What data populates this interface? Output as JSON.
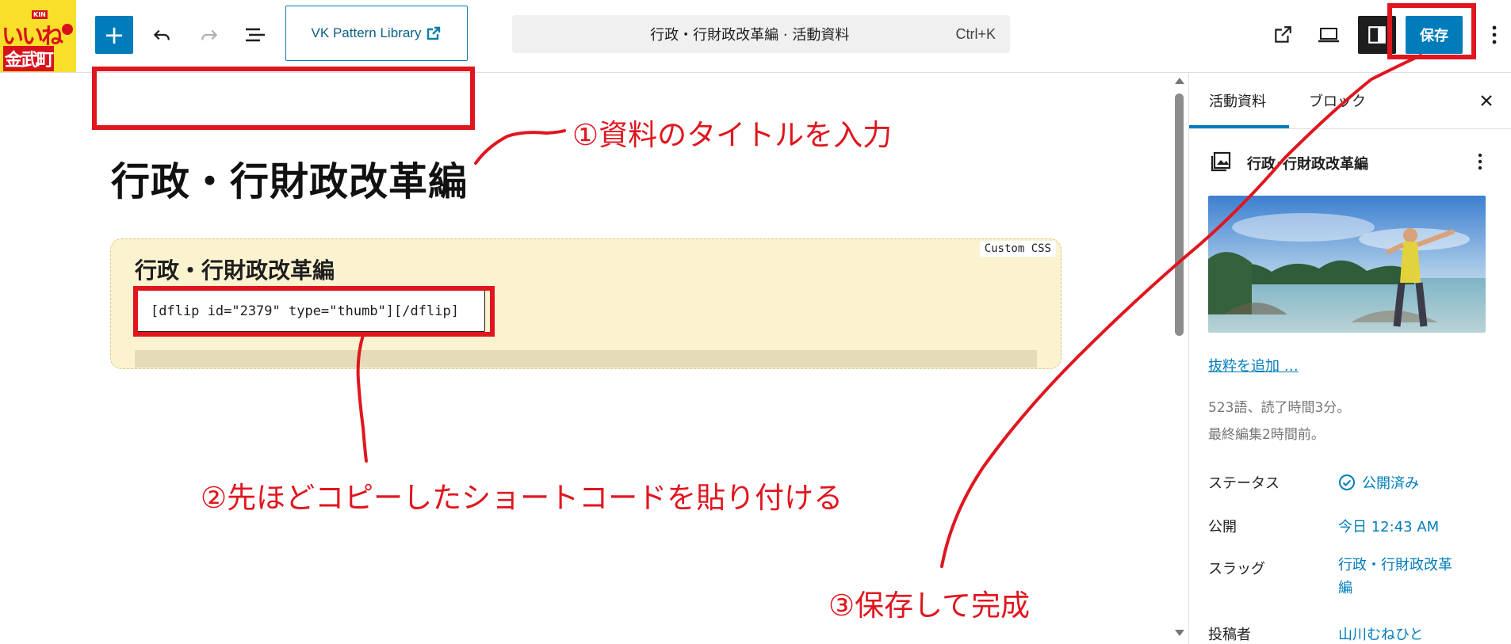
{
  "topbar": {
    "logo": {
      "line1": "いいね",
      "line2": "金武町",
      "badge": "KIN"
    },
    "vk_pattern_label": "VK Pattern Library",
    "command_title": "行政・行財政改革編 · 活動資料",
    "command_shortcut": "Ctrl+K",
    "save_label": "保存",
    "add_label": "+"
  },
  "canvas": {
    "post_title": "行政・行財政改革編",
    "custom_css_label": "Custom CSS",
    "block_heading": "行政・行財政改革編",
    "shortcode": "[dflip id=\"2379\" type=\"thumb\"][/dflip]"
  },
  "annotations": {
    "a1": "①資料のタイトルを入力",
    "a2": "②先ほどコピーしたショートコードを貼り付ける",
    "a3": "③保存して完成"
  },
  "sidebar": {
    "tab_document": "活動資料",
    "tab_block": "ブロック",
    "doc_title": "行政･行財政改革編",
    "add_excerpt": "抜粋を追加 …",
    "word_count": "523語、読了時間3分。",
    "last_edited": "最終編集2時間前。",
    "status_label": "ステータス",
    "status_value": "公開済み",
    "publish_label": "公開",
    "publish_value": "今日 12:43 AM",
    "slug_label": "スラッグ",
    "slug_value": "行政・行財政改革編",
    "author_label": "投稿者",
    "author_value": "山川むねひと"
  },
  "colors": {
    "accent": "#007cba",
    "annotation": "#e0161f",
    "block_bg": "#fbf2d0"
  }
}
